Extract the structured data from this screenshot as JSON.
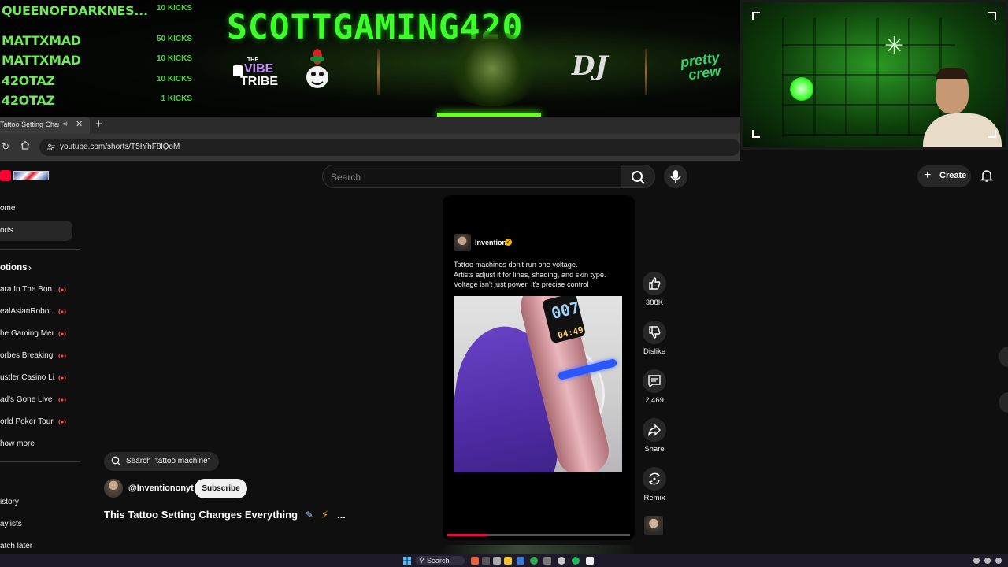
{
  "overlay": {
    "kicks": [
      {
        "name": "QUEENOFDARKNES...",
        "amount": "10 KICKS"
      },
      {
        "name": "MATTXMAD",
        "amount": "50 KICKS"
      },
      {
        "name": "MATTXMAD",
        "amount": "10 KICKS"
      },
      {
        "name": "42OTAZ",
        "amount": "10 KICKS"
      },
      {
        "name": "42OTAZ",
        "amount": "1 KICKS"
      }
    ],
    "banner_title": "SCOTTGAMING420",
    "vibe_tribe": {
      "line1": "THE",
      "line2": "VIBE",
      "line3": "TRIBE"
    },
    "dj_logo": "DJ",
    "pretty_crew": {
      "line1": "pretty",
      "line2": "crew"
    }
  },
  "browser": {
    "tab_title": "Tattoo Setting Changes Everything",
    "url": "youtube.com/shorts/T5IYhF8lQoM",
    "new_tab_symbol": "+",
    "close_symbol": "✕"
  },
  "youtube": {
    "search_placeholder": "Search",
    "create_label": "Create",
    "create_symbol": "+",
    "sidebar": {
      "items": [
        {
          "label": "ome"
        },
        {
          "label": "orts"
        }
      ],
      "subscriptions_label": "otions",
      "subscriptions": [
        {
          "label": "ara In The Bon..."
        },
        {
          "label": "ealAsianRobot"
        },
        {
          "label": "he Gaming Mer..."
        },
        {
          "label": "orbes Breaking ..."
        },
        {
          "label": "ustler Casino Li..."
        },
        {
          "label": "ad's Gone Live"
        },
        {
          "label": "orld Poker Tour"
        }
      ],
      "show_more": "how more",
      "you_items": [
        {
          "label": "istory"
        },
        {
          "label": "aylists"
        },
        {
          "label": "atch later"
        }
      ]
    },
    "related_search_chip": "Search \"tattoo machine\"",
    "channel_handle": "@Inventiononyt",
    "subscribe_label": "Subscribe",
    "video_title": "This Tattoo Setting Changes Everything",
    "title_more": "...",
    "short": {
      "channel_name": "Invention",
      "caption_lines": [
        "Tattoo machines don't run one voltage.",
        "Artists adjust it for lines, shading, and skin type.",
        "Voltage isn't just power, it's precise control"
      ],
      "device_voltage": "007",
      "device_time": "04:49",
      "progress_fraction": 0.22
    },
    "actions": [
      {
        "label": "388K"
      },
      {
        "label": "Dislike"
      },
      {
        "label": "2,469"
      },
      {
        "label": "Share"
      },
      {
        "label": "Remix"
      }
    ]
  },
  "taskbar": {
    "search_label": "Search"
  },
  "colors": {
    "kick_green": "#6fe85a",
    "banner_green": "#3cff2a",
    "youtube_red": "#ff0033",
    "background": "#0f0f0f"
  }
}
